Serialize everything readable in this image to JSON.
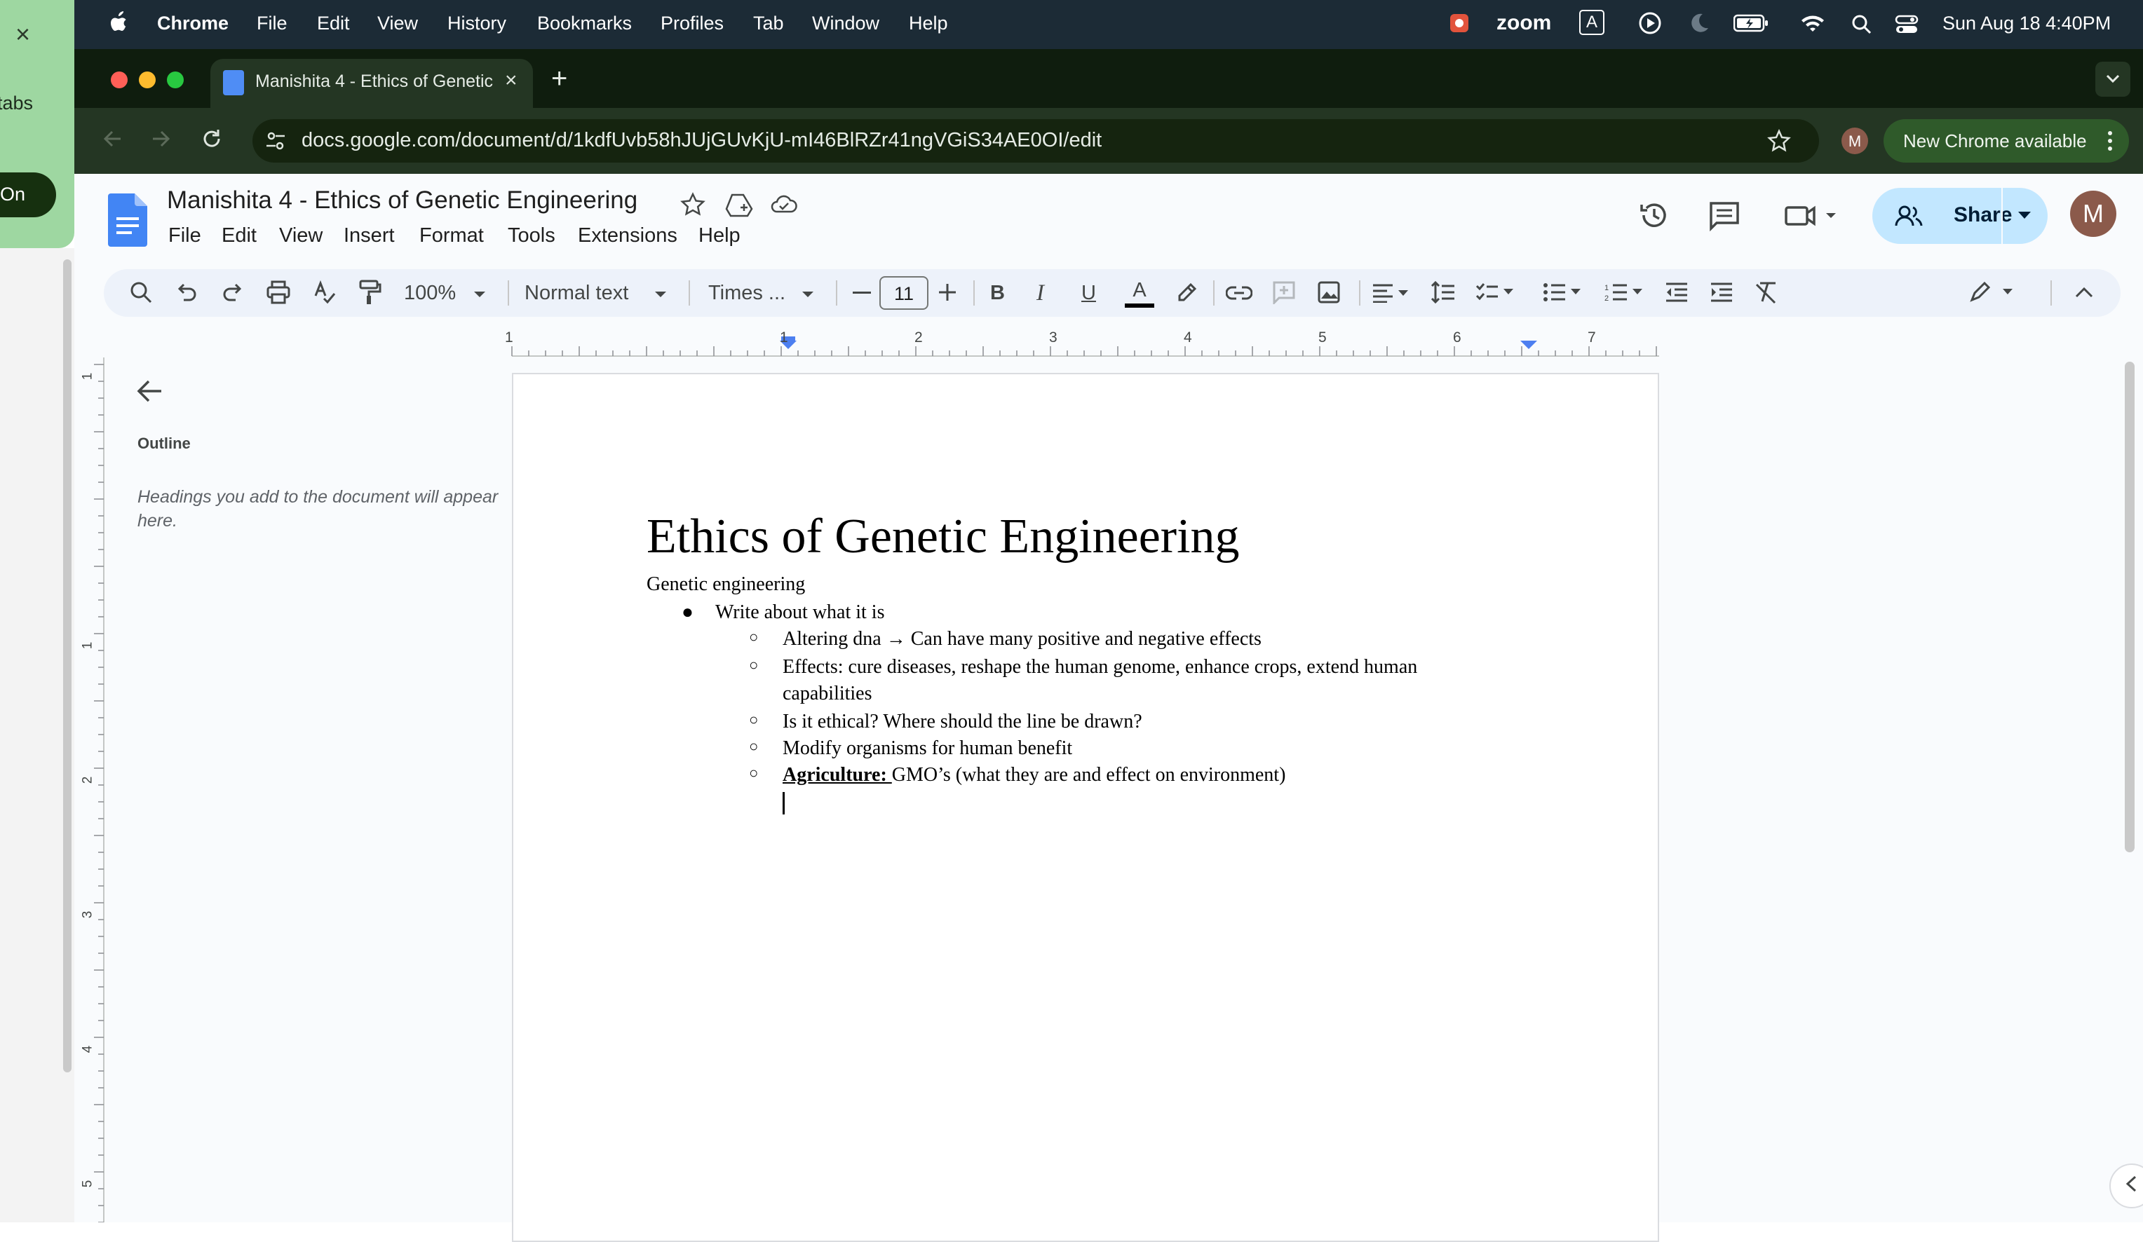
{
  "menubar": {
    "app": "Chrome",
    "items": [
      "File",
      "Edit",
      "View",
      "History",
      "Bookmarks",
      "Profiles",
      "Tab",
      "Window",
      "Help"
    ],
    "zoom": "zoom",
    "input_source": "A",
    "datetime": "Sun Aug 18  4:40PM"
  },
  "popup": {
    "close": "×",
    "text": "tabs",
    "button": "On"
  },
  "browser": {
    "tab_title": "Manishita 4 - Ethics of Genetic Engineering",
    "tab_close": "×",
    "new_tab": "+",
    "url": "docs.google.com/document/d/1kdfUvb58hJUjGUvKjU-mI46BlRZr41ngVGiS34AE0OI/edit",
    "profile_initial": "M",
    "update_label": "New Chrome available"
  },
  "docs": {
    "title": "Manishita 4 - Ethics of Genetic Engineering",
    "menu": [
      "File",
      "Edit",
      "View",
      "Insert",
      "Format",
      "Tools",
      "Extensions",
      "Help"
    ],
    "share_label": "Share",
    "avatar_initial": "M",
    "toolbar": {
      "zoom": "100%",
      "style": "Normal text",
      "font": "Times ...",
      "font_size": "11",
      "bold": "B",
      "italic": "I",
      "underline": "U",
      "text_color": "A"
    },
    "ruler_numbers": [
      "1",
      "1",
      "2",
      "3",
      "4",
      "5",
      "6",
      "7"
    ],
    "vruler_numbers": [
      "1",
      "1",
      "2",
      "3",
      "4",
      "5"
    ]
  },
  "outline": {
    "label": "Outline",
    "hint": "Headings you add to the document will appear here."
  },
  "document": {
    "heading": "Ethics of Genetic Engineering",
    "subtitle": "Genetic engineering",
    "bullet1": "Write about what it is",
    "sub_bullets": [
      "Altering dna → Can have many positive and negative effects",
      "Effects: cure diseases, reshape the human genome, enhance crops, extend human",
      "capabilities",
      "Is it ethical? Where should the line be drawn?",
      "Modify organisms for human benefit"
    ],
    "agri_label": "Agriculture: ",
    "agri_text": "GMO’s  (what they are and effect on environment)"
  }
}
